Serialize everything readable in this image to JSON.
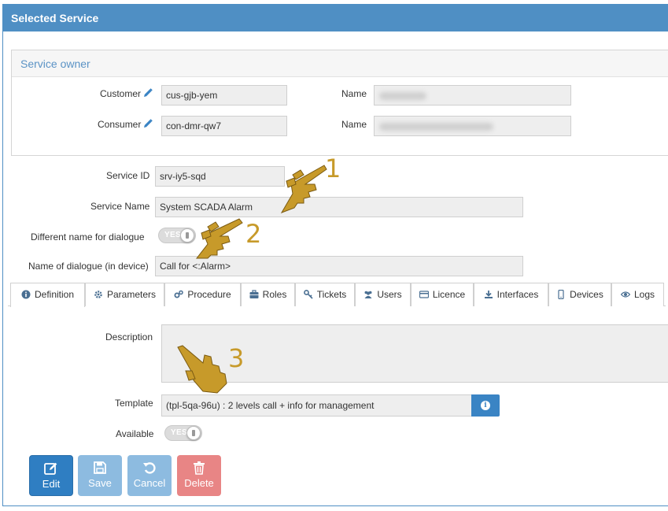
{
  "panel": {
    "title": "Selected Service"
  },
  "owner": {
    "title": "Service owner",
    "customer_label": "Customer",
    "customer_value": "cus-gjb-yem",
    "consumer_label": "Consumer",
    "consumer_value": "con-dmr-qw7",
    "name_label_1": "Name",
    "name_label_2": "Name"
  },
  "service": {
    "id_label": "Service ID",
    "id_value": "srv-iy5-sqd",
    "name_label": "Service Name",
    "name_value": "System SCADA Alarm",
    "diff_name_label": "Different name for dialogue",
    "diff_name_toggle": "YES",
    "dialogue_label": "Name of dialogue (in device)",
    "dialogue_value": "Call for <:Alarm>"
  },
  "tabs": [
    {
      "label": "Definition",
      "icon": "info-circle-icon"
    },
    {
      "label": "Parameters",
      "icon": "gear-icon"
    },
    {
      "label": "Procedure",
      "icon": "gears-icon"
    },
    {
      "label": "Roles",
      "icon": "briefcase-icon"
    },
    {
      "label": "Tickets",
      "icon": "key-icon"
    },
    {
      "label": "Users",
      "icon": "users-icon"
    },
    {
      "label": "Licence",
      "icon": "credit-card-icon"
    },
    {
      "label": "Interfaces",
      "icon": "download-icon"
    },
    {
      "label": "Devices",
      "icon": "mobile-icon"
    },
    {
      "label": "Logs",
      "icon": "eye-icon"
    }
  ],
  "definition": {
    "description_label": "Description",
    "description_value": "",
    "template_label": "Template",
    "template_value": "(tpl-5qa-96u) : 2 levels call + info for management",
    "available_label": "Available",
    "available_toggle": "YES"
  },
  "actions": {
    "edit": "Edit",
    "save": "Save",
    "cancel": "Cancel",
    "delete": "Delete"
  },
  "annotations": [
    "1",
    "2",
    "3"
  ],
  "colors": {
    "header_blue": "#4f8fc4",
    "edit_blue": "#2f7ec2",
    "disabled_blue": "#8dbbe0",
    "delete_red": "#e88585",
    "hand_gold": "#c79a2a"
  }
}
